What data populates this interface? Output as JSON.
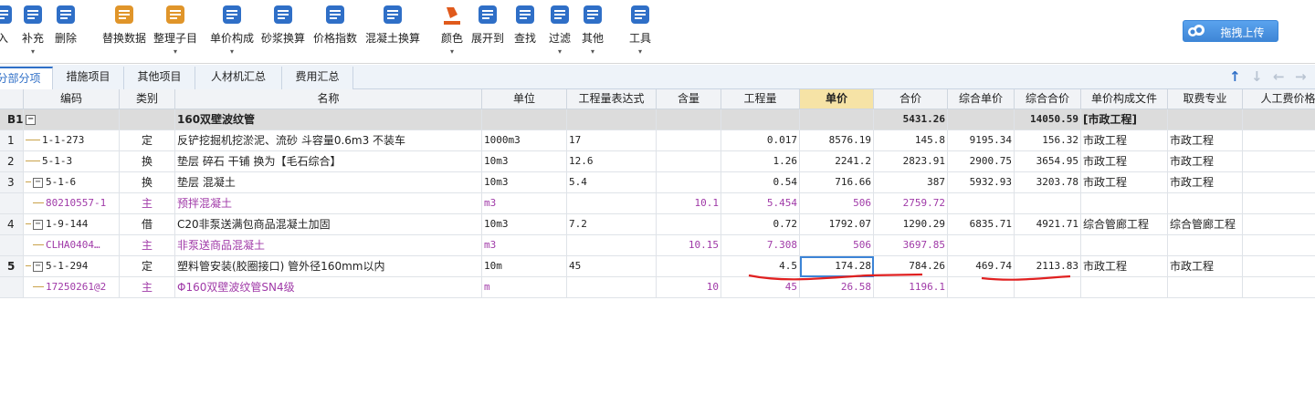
{
  "toolbar": {
    "items": [
      {
        "label": "入",
        "icon": "import-icon"
      },
      {
        "label": "补充",
        "icon": "add-icon"
      },
      {
        "label": "删除",
        "icon": "delete-icon"
      },
      {
        "label": "替换数据",
        "icon": "replace-icon"
      },
      {
        "label": "整理子目",
        "icon": "organize-icon"
      },
      {
        "label": "单价构成",
        "icon": "price-icon"
      },
      {
        "label": "砂浆换算",
        "icon": "mortar-icon"
      },
      {
        "label": "价格指数",
        "icon": "index-icon"
      },
      {
        "label": "混凝土换算",
        "icon": "concrete-icon"
      },
      {
        "label": "颜色",
        "icon": "color-icon"
      },
      {
        "label": "展开到",
        "icon": "expand-icon"
      },
      {
        "label": "查找",
        "icon": "find-icon"
      },
      {
        "label": "过滤",
        "icon": "filter-icon"
      },
      {
        "label": "其他",
        "icon": "other-icon"
      },
      {
        "label": "工具",
        "icon": "tool-icon"
      }
    ],
    "upload_label": "拖拽上传"
  },
  "tabs": [
    "分部分项",
    "措施项目",
    "其他项目",
    "人材机汇总",
    "费用汇总"
  ],
  "columns": [
    "编码",
    "类别",
    "名称",
    "单位",
    "工程量表达式",
    "含量",
    "工程量",
    "单价",
    "合价",
    "综合单价",
    "综合合价",
    "单价构成文件",
    "取费专业",
    "人工费价格"
  ],
  "rows": [
    {
      "no": "B1",
      "code": "",
      "type": "",
      "name": "160双壁波纹管",
      "unit": "",
      "expr": "",
      "content": "",
      "qty": "",
      "price": "",
      "total": "5431.26",
      "cprice": "",
      "ctotal": "14050.59",
      "file": "[市政工程]",
      "major": ""
    },
    {
      "no": "1",
      "code": "1-1-273",
      "type": "定",
      "name": "反铲挖掘机挖淤泥、流砂 斗容量0.6m3 不装车",
      "unit": "1000m3",
      "expr": "17",
      "content": "",
      "qty": "0.017",
      "price": "8576.19",
      "total": "145.8",
      "cprice": "9195.34",
      "ctotal": "156.32",
      "file": "市政工程",
      "major": "市政工程"
    },
    {
      "no": "2",
      "code": "5-1-3",
      "type": "换",
      "name": "垫层 碎石 干铺  换为【毛石综合】",
      "unit": "10m3",
      "expr": "12.6",
      "content": "",
      "qty": "1.26",
      "price": "2241.2",
      "total": "2823.91",
      "cprice": "2900.75",
      "ctotal": "3654.95",
      "file": "市政工程",
      "major": "市政工程"
    },
    {
      "no": "3",
      "code": "5-1-6",
      "type": "换",
      "name": "垫层 混凝土",
      "unit": "10m3",
      "expr": "5.4",
      "content": "",
      "qty": "0.54",
      "price": "716.66",
      "total": "387",
      "cprice": "5932.93",
      "ctotal": "3203.78",
      "file": "市政工程",
      "major": "市政工程"
    },
    {
      "no": "",
      "code": "80210557-1",
      "type": "主",
      "name": "预拌混凝土",
      "unit": "m3",
      "expr": "",
      "content": "10.1",
      "qty": "5.454",
      "price": "506",
      "total": "2759.72",
      "cprice": "",
      "ctotal": "",
      "file": "",
      "major": ""
    },
    {
      "no": "4",
      "code": "1-9-144",
      "type": "借",
      "name": "C20非泵送满包商品混凝土加固",
      "unit": "10m3",
      "expr": "7.2",
      "content": "",
      "qty": "0.72",
      "price": "1792.07",
      "total": "1290.29",
      "cprice": "6835.71",
      "ctotal": "4921.71",
      "file": "综合管廊工程",
      "major": "综合管廊工程"
    },
    {
      "no": "",
      "code": "CLHA0404…",
      "type": "主",
      "name": "非泵送商品混凝土",
      "unit": "m3",
      "expr": "",
      "content": "10.15",
      "qty": "7.308",
      "price": "506",
      "total": "3697.85",
      "cprice": "",
      "ctotal": "",
      "file": "",
      "major": ""
    },
    {
      "no": "5",
      "code": "5-1-294",
      "type": "定",
      "name": "塑料管安装(胶圈接口) 管外径160mm以内",
      "unit": "10m",
      "expr": "45",
      "content": "",
      "qty": "4.5",
      "price": "174.28",
      "total": "784.26",
      "cprice": "469.74",
      "ctotal": "2113.83",
      "file": "市政工程",
      "major": "市政工程"
    },
    {
      "no": "",
      "code": "17250261@2",
      "type": "主",
      "name": "Φ160双壁波纹管SN4级",
      "unit": "m",
      "expr": "",
      "content": "10",
      "qty": "45",
      "price": "26.58",
      "total": "1196.1",
      "cprice": "",
      "ctotal": "",
      "file": "",
      "major": ""
    }
  ],
  "colors": {
    "accent": "#2f6fc7",
    "purple": "#a03aa8",
    "highlight": "#f6e3a6",
    "annotation": "#e02020"
  }
}
